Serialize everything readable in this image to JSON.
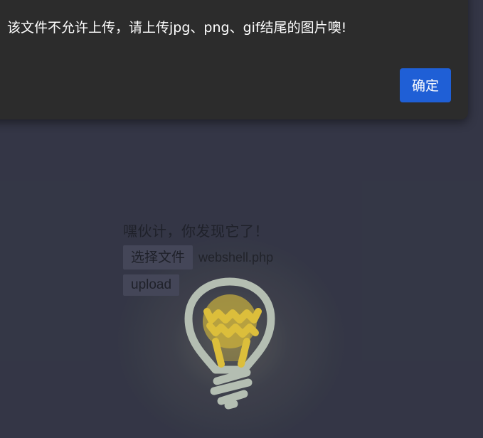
{
  "page": {
    "heading": "嘿伙计，你发现它了！",
    "file_button_label": "选择文件",
    "file_name": "webshell.php",
    "upload_button_label": "upload"
  },
  "dialog": {
    "message": "该文件不允许上传，请上传jpg、png、gif结尾的图片噢!",
    "ok_label": "确定"
  },
  "colors": {
    "page_background": "#3a3d4e",
    "dialog_background": "#2c2c2c",
    "ok_button": "#1f5fd6",
    "bulb_outline": "#c9d4c7",
    "bulb_filament": "#f5d442"
  },
  "icons": {
    "bulb": "lightbulb-icon"
  }
}
